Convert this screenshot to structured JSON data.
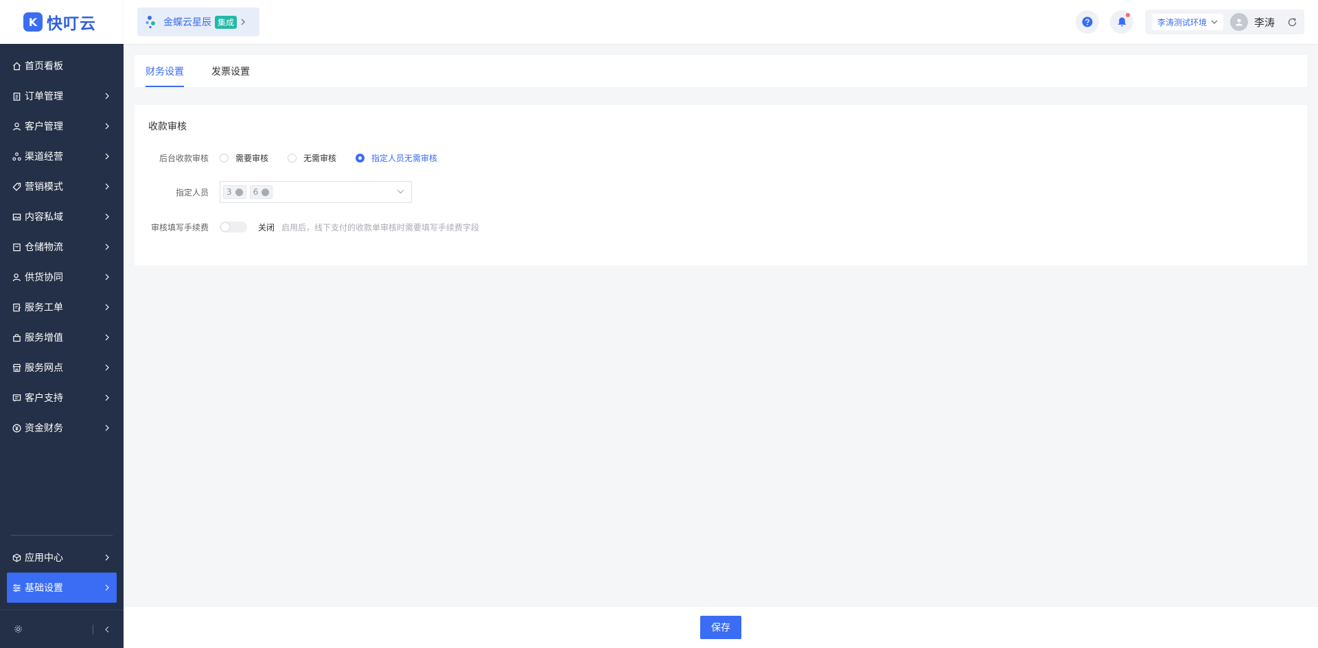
{
  "brand": {
    "logo_glyph": "K",
    "name": "快叮云",
    "color": "#3a6cf4"
  },
  "header": {
    "app_chip": {
      "name": "金蝶云星辰",
      "badge": "集成"
    },
    "env": "李涛测试环境",
    "user_name": "李涛"
  },
  "sidebar": {
    "items": [
      {
        "label": "首页看板",
        "icon": "home-icon"
      },
      {
        "label": "订单管理",
        "icon": "clipboard-icon"
      },
      {
        "label": "客户管理",
        "icon": "user-icon"
      },
      {
        "label": "渠道经营",
        "icon": "channel-icon"
      },
      {
        "label": "营销模式",
        "icon": "tag-icon"
      },
      {
        "label": "内容私域",
        "icon": "image-icon"
      },
      {
        "label": "仓储物流",
        "icon": "box-icon"
      },
      {
        "label": "供货协同",
        "icon": "supplier-icon"
      },
      {
        "label": "服务工单",
        "icon": "ticket-icon"
      },
      {
        "label": "服务增值",
        "icon": "bag-icon"
      },
      {
        "label": "服务网点",
        "icon": "store-icon"
      },
      {
        "label": "客户支持",
        "icon": "support-icon"
      },
      {
        "label": "资金财务",
        "icon": "yuan-icon"
      }
    ],
    "bottom_items": [
      {
        "label": "应用中心",
        "icon": "cube-icon"
      },
      {
        "label": "基础设置",
        "icon": "settings-list-icon",
        "active": true
      }
    ]
  },
  "tabs": [
    {
      "label": "财务设置",
      "active": true
    },
    {
      "label": "发票设置",
      "active": false
    }
  ],
  "panel": {
    "title": "收款审核",
    "review": {
      "label": "后台收款审核",
      "options": [
        "需要审核",
        "无需审核",
        "指定人员无需审核"
      ],
      "selected": "指定人员无需审核"
    },
    "assignee": {
      "label": "指定人员",
      "tags": [
        "3",
        "6"
      ]
    },
    "fee": {
      "label": "审核填写手续费",
      "state": "关闭",
      "hint": "启用后，线下支付的收款单审核时需要填写手续费字段"
    }
  },
  "footer": {
    "save_label": "保存"
  }
}
